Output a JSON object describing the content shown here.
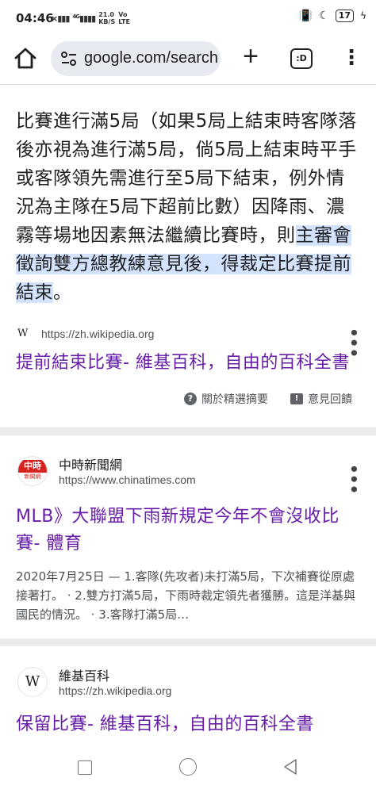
{
  "status_bar": {
    "time": "04:46",
    "network_speed_value": "21.0",
    "network_speed_unit": "KB/S",
    "network_type": "Vo LTE",
    "signal": "4G",
    "battery": "17"
  },
  "browser": {
    "url": "google.com/search",
    "tab_label": ":D",
    "icons": [
      "home-icon",
      "tune-icon",
      "plus-icon",
      "tab-switcher-icon",
      "overflow-menu-icon"
    ]
  },
  "featured_snippet": {
    "text_before": "比賽進行滿5局（如果5局上結束時客隊落後亦視為進行滿5局，倘5局上結束時平手或客隊領先需進行至5局下結束，例外情況為主隊在5局下超前比數）因降雨、濃霧等場地因素無法繼續比賽時，則",
    "text_highlight": "主審會徵詢雙方總教練意見後，得裁定比賽提前結束",
    "text_after": "。",
    "source_url": "https://zh.wikipedia.org",
    "title": "提前結束比賽- 維基百科，自由的百科全書",
    "about_label": "關於精選摘要",
    "feedback_label": "意見回饋"
  },
  "results": [
    {
      "site_name": "中時新聞網",
      "logo_text_top": "中時",
      "logo_text_bottom": "新聞網",
      "url": "https://www.chinatimes.com",
      "title": "MLB》大聯盟下雨新規定今年不會沒收比賽- 體育",
      "description": "2020年7月25日 — 1.客隊(先攻者)未打滿5局，下次補賽從原處接著打。 · 2.雙方打滿5局，下雨時裁定領先者獲勝。這是洋基與國民的情況。 · 3.客隊打滿5局…"
    },
    {
      "site_name": "維基百科",
      "logo_text": "W",
      "url": "https://zh.wikipedia.org",
      "title": "保留比賽- 維基百科，自由的百科全書"
    }
  ],
  "colors": {
    "link_visited": "#681da8",
    "highlight": "#d3e3fd",
    "omnibox_bg": "#e8eaf1",
    "divider": "#ebebeb",
    "chinatimes_red": "#d7221f"
  }
}
